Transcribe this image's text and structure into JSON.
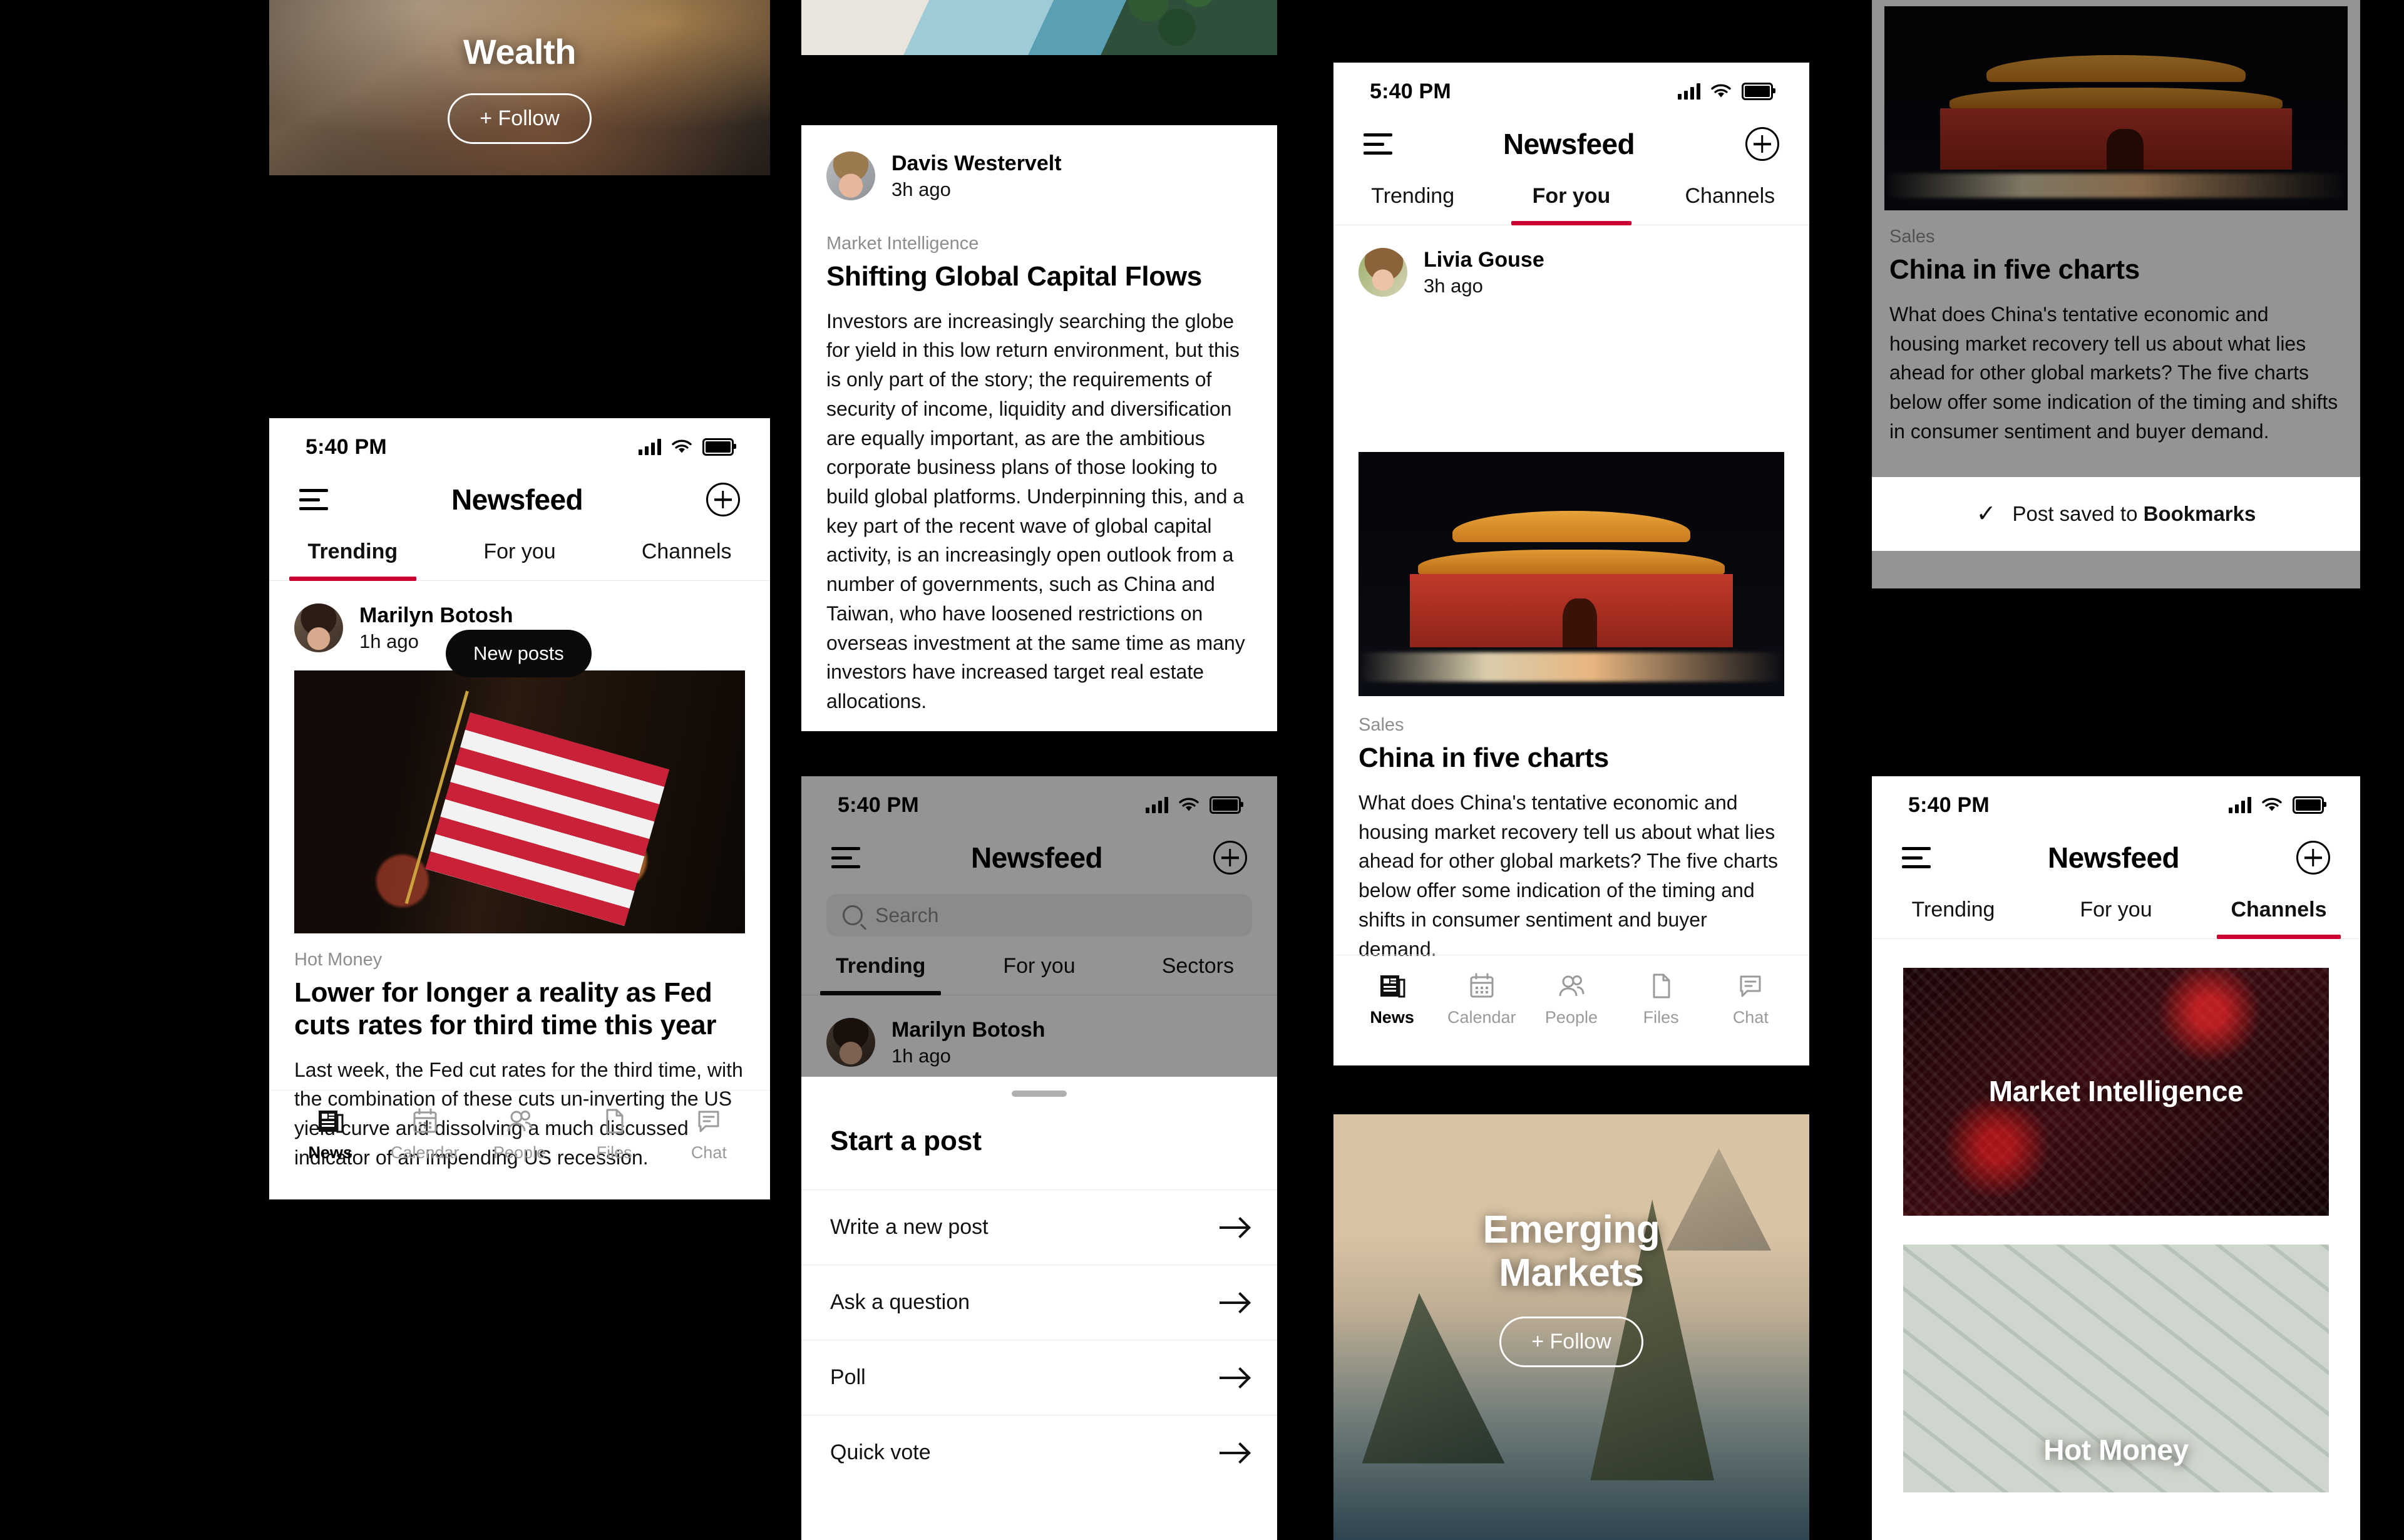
{
  "accent": "#cc0033",
  "status_bar": {
    "time": "5:40 PM",
    "signal_icon": "cellular-bars-icon",
    "wifi_icon": "wifi-icon",
    "battery_icon": "battery-icon"
  },
  "app": {
    "title": "Newsfeed",
    "menu_icon": "hamburger-menu-icon",
    "compose_icon": "plus-circle-icon",
    "search_placeholder": "Search"
  },
  "tabs_main": [
    {
      "label": "Trending"
    },
    {
      "label": "For you"
    },
    {
      "label": "Channels"
    }
  ],
  "tabs_sectors": [
    {
      "label": "Trending"
    },
    {
      "label": "For you"
    },
    {
      "label": "Sectors"
    }
  ],
  "bottom_nav": [
    {
      "label": "News",
      "icon": "news-icon"
    },
    {
      "label": "Calendar",
      "icon": "calendar-icon"
    },
    {
      "label": "People",
      "icon": "people-icon"
    },
    {
      "label": "Files",
      "icon": "file-icon"
    },
    {
      "label": "Chat",
      "icon": "chat-icon"
    }
  ],
  "channel_hero_wealth": {
    "name": "Wealth",
    "follow_label": "+ Follow"
  },
  "channel_hero_emerging": {
    "name": "Emerging\nMarkets",
    "follow_label": "+ Follow"
  },
  "new_posts_pill": {
    "label": "New posts"
  },
  "post_marilyn": {
    "author": "Marilyn Botosh",
    "time": "1h ago",
    "kicker": "Hot Money",
    "title": "Lower for longer a reality as Fed cuts rates for third time this year",
    "body": "Last week, the Fed cut rates for the third time, with the combination of these cuts un-inverting the US yield curve and dissolving a much discussed indicator of an impending US recession."
  },
  "post_davis": {
    "author": "Davis Westervelt",
    "time": "3h ago",
    "kicker": "Market Intelligence",
    "title": "Shifting Global Capital Flows",
    "body": "Investors are increasingly searching the globe for yield in this low return environment, but this is only part of the story; the requirements of security of income, liquidity and diversification are equally important, as are the ambitious corporate business plans of those looking to build global platforms. Underpinning this, and a key part of the recent wave of global capital activity, is an increasingly open outlook from a number of governments, such as China and Taiwan, who have loosened restrictions on overseas investment at the same time as many investors have increased target real estate allocations."
  },
  "post_livia": {
    "author": "Livia Gouse",
    "time": "3h ago",
    "kicker": "Sales",
    "title": "China in five charts",
    "body": "What does China's tentative economic and housing market recovery tell us about what lies ahead for other global markets? The five charts below offer some indication of the timing and shifts in consumer sentiment and buyer demand."
  },
  "start_post_sheet": {
    "title": "Start a post",
    "options": [
      {
        "label": "Write a new post",
        "icon": "arrow-right-icon"
      },
      {
        "label": "Ask a question",
        "icon": "arrow-right-icon"
      },
      {
        "label": "Poll",
        "icon": "arrow-right-icon"
      },
      {
        "label": "Quick vote",
        "icon": "arrow-right-icon"
      }
    ]
  },
  "bookmark_toast": {
    "check_icon": "check-icon",
    "message_prefix": "Post saved to ",
    "message_target": "Bookmarks"
  },
  "channel_cards": [
    {
      "name": "Market Intelligence"
    },
    {
      "name": "Hot Money"
    }
  ]
}
